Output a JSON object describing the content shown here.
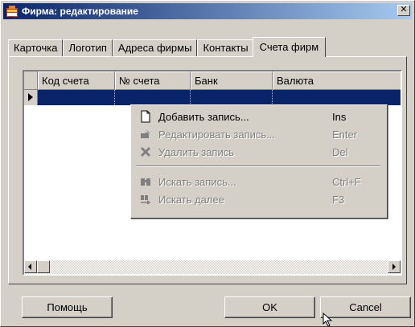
{
  "window": {
    "title": "Фирма: редактирование",
    "close_glyph": "✕"
  },
  "tabs": [
    {
      "label": "Карточка"
    },
    {
      "label": "Логотип"
    },
    {
      "label": "Адреса фирмы"
    },
    {
      "label": "Контакты"
    },
    {
      "label": "Счета фирм"
    }
  ],
  "active_tab": "Счета фирм",
  "grid": {
    "columns": [
      "Код счета",
      "№ счета",
      "Банк",
      "Валюта"
    ],
    "selected_row_color": "#0a246a"
  },
  "context_menu": {
    "items": [
      {
        "label": "Добавить запись...",
        "shortcut": "Ins",
        "icon": "new-document-icon",
        "enabled": true
      },
      {
        "label": "Редактировать запись...",
        "shortcut": "Enter",
        "icon": "edit-icon",
        "enabled": false
      },
      {
        "label": "Удалить запись",
        "shortcut": "Del",
        "icon": "delete-icon",
        "enabled": false
      },
      {
        "label": "Искать запись...",
        "shortcut": "Ctrl+F",
        "icon": "binoculars-icon",
        "enabled": false
      },
      {
        "label": "Искать далее",
        "shortcut": "F3",
        "icon": "find-next-icon",
        "enabled": false
      }
    ]
  },
  "buttons": {
    "help": "Помощь",
    "ok": "OK",
    "cancel": "Cancel"
  },
  "colors": {
    "titlebar_start": "#0a246a",
    "titlebar_end": "#a6caf0",
    "face": "#d4d0c8"
  }
}
